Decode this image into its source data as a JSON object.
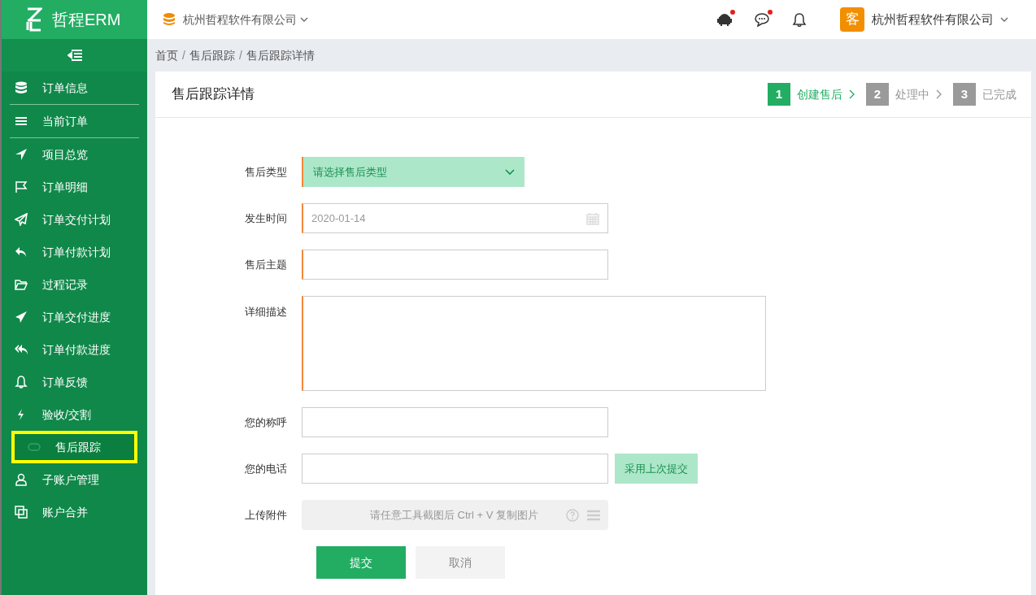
{
  "logo": {
    "text": "哲程ERM"
  },
  "header": {
    "company_switch": "杭州哲程软件有限公司",
    "company_expanded": false,
    "notifications": [
      {
        "badge": true
      },
      {
        "badge": true
      },
      {
        "badge": false
      }
    ],
    "avatar": "客",
    "user": "杭州哲程软件有限公司"
  },
  "sidebar": {
    "items": [
      {
        "label": "订单信息",
        "selected": false,
        "divider": true
      },
      {
        "label": "当前订单",
        "selected": false,
        "divider": true
      },
      {
        "label": "项目总览",
        "selected": false,
        "divider": false
      },
      {
        "label": "订单明细",
        "selected": false,
        "divider": false
      },
      {
        "label": "订单交付计划",
        "selected": false,
        "divider": false
      },
      {
        "label": "订单付款计划",
        "selected": false,
        "divider": false
      },
      {
        "label": "过程记录",
        "selected": false,
        "divider": false
      },
      {
        "label": "订单交付进度",
        "selected": false,
        "divider": false
      },
      {
        "label": "订单付款进度",
        "selected": false,
        "divider": false
      },
      {
        "label": "订单反馈",
        "selected": false,
        "divider": false
      },
      {
        "label": "验收/交割",
        "selected": false,
        "divider": false
      },
      {
        "label": "售后跟踪",
        "selected": true,
        "divider": false
      },
      {
        "label": "子账户管理",
        "selected": false,
        "divider": false
      },
      {
        "label": "账户合并",
        "selected": false,
        "divider": false
      }
    ]
  },
  "breadcrumb": [
    {
      "kind": "link",
      "text": "首页"
    },
    {
      "kind": "separator",
      "text": "/"
    },
    {
      "kind": "link",
      "text": "售后跟踪"
    },
    {
      "kind": "separator",
      "text": "/"
    },
    {
      "kind": "link",
      "text": "售后跟踪详情"
    }
  ],
  "card": {
    "title": "售后跟踪详情",
    "steps": [
      {
        "number": "1",
        "label": "创建售后",
        "selected": true
      },
      {
        "number": "2",
        "label": "处理中",
        "selected": false
      },
      {
        "number": "3",
        "label": "已完成",
        "selected": false
      }
    ],
    "form": [
      {
        "kind": "select",
        "label": "售后类型",
        "required": true,
        "placeholder": "请选择售后类型"
      },
      {
        "kind": "date",
        "label": "发生时间",
        "required": true,
        "value": "2020-01-14"
      },
      {
        "kind": "text",
        "label": "售后主题",
        "required": true
      },
      {
        "kind": "textarea",
        "label": "详细描述",
        "required": true
      },
      {
        "kind": "text",
        "label": "您的称呼",
        "required": false
      },
      {
        "kind": "text",
        "label": "您的电话",
        "required": false,
        "button": "采用上次提交"
      },
      {
        "kind": "upload",
        "label": "上传附件",
        "required": false,
        "hint": "请任意工具截图后 Ctrl + V 复制图片"
      }
    ],
    "buttons": [
      {
        "label": "提交",
        "kind": "primary"
      },
      {
        "label": "取消",
        "kind": "secondary"
      }
    ]
  }
}
